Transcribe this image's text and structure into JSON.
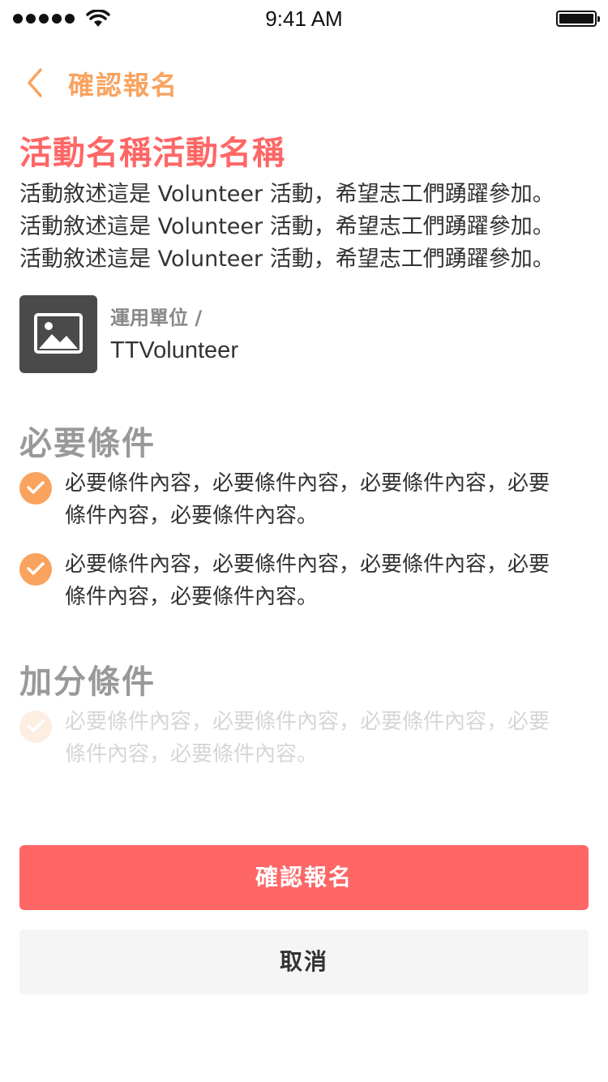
{
  "status_bar": {
    "time": "9:41 AM",
    "signal_icon": "signal-dots-icon",
    "wifi_icon": "wifi-icon",
    "battery_icon": "battery-icon"
  },
  "nav": {
    "back_icon": "chevron-left-icon",
    "title": "確認報名"
  },
  "event": {
    "title": "活動名稱活動名稱",
    "description_lines": [
      "活動敘述這是 Volunteer 活動，希望志工們踴躍參加。",
      "活動敘述這是 Volunteer 活動，希望志工們踴躍參加。",
      "活動敘述這是 Volunteer 活動，希望志工們踴躍參加。"
    ]
  },
  "organization": {
    "image_icon": "image-placeholder-icon",
    "label": "運用單位 /",
    "name": "TTVolunteer"
  },
  "required": {
    "title": "必要條件",
    "items": [
      {
        "line1": "必要條件內容，必要條件內容，必要條件內容，必要",
        "line2": "條件內容，必要條件內容。",
        "checked": true
      },
      {
        "line1": "必要條件內容，必要條件內容，必要條件內容，必要",
        "line2": "條件內容，必要條件內容。",
        "checked": true
      }
    ]
  },
  "bonus": {
    "title": "加分條件",
    "items": [
      {
        "line1": "必要條件內容，必要條件內容，必要條件內容，必要",
        "line2": "條件內容，必要條件內容。",
        "checked": false
      }
    ]
  },
  "actions": {
    "confirm_label": "確認報名",
    "cancel_label": "取消"
  },
  "colors": {
    "accent_orange": "#f9a35f",
    "accent_red": "#ff6666",
    "section_gray": "#999999"
  }
}
